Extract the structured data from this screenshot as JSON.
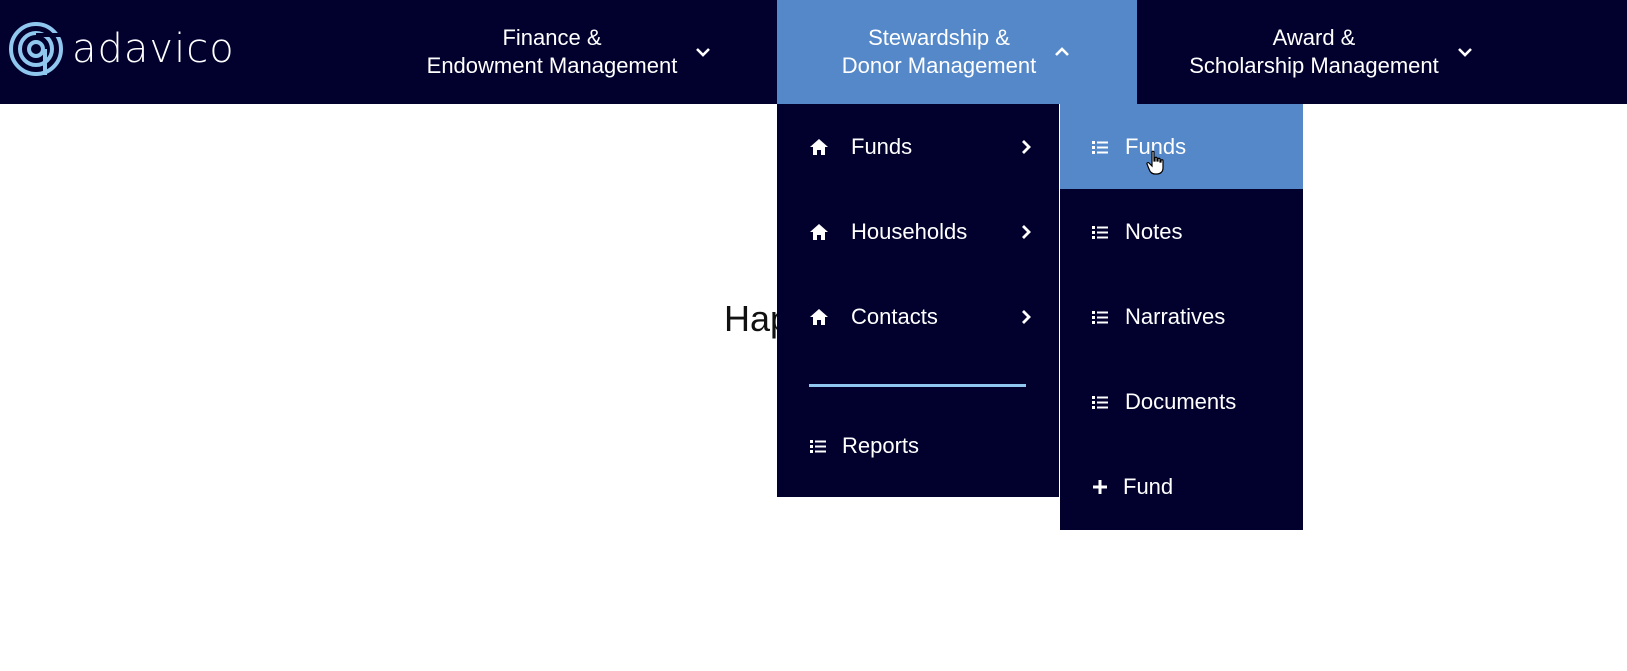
{
  "brand": {
    "name": "adavico"
  },
  "nav": {
    "finance": {
      "line1": "Finance &",
      "line2": "Endowment Management"
    },
    "stewardship": {
      "line1": "Stewardship &",
      "line2": "Donor Management"
    },
    "award": {
      "line1": "Award &",
      "line2": "Scholarship Management"
    }
  },
  "page": {
    "partial_heading": "Hap"
  },
  "stewardship_menu": {
    "items": [
      {
        "label": "Funds",
        "icon": "home-icon"
      },
      {
        "label": "Households",
        "icon": "home-icon"
      },
      {
        "label": "Contacts",
        "icon": "home-icon"
      }
    ],
    "reports_label": "Reports"
  },
  "funds_submenu": {
    "items": [
      {
        "label": "Funds",
        "icon": "list-icon"
      },
      {
        "label": "Notes",
        "icon": "list-icon"
      },
      {
        "label": "Narratives",
        "icon": "list-icon"
      },
      {
        "label": "Documents",
        "icon": "list-icon"
      },
      {
        "label": "Fund",
        "icon": "plus-icon"
      }
    ]
  },
  "colors": {
    "navy": "#02012e",
    "accent": "#5588c9",
    "divider": "#8fc7ef",
    "logo": "#8fc7ef"
  }
}
